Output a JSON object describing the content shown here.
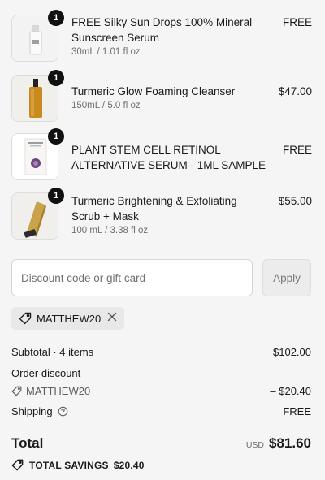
{
  "cart": {
    "items": [
      {
        "quantity": "1",
        "name": "FREE Silky Sun Drops 100% Mineral Sunscreen Serum",
        "variant": "30mL / 1.01 fl oz",
        "price": "FREE"
      },
      {
        "quantity": "1",
        "name": "Turmeric Glow Foaming Cleanser",
        "variant": "150mL / 5.0 fl oz",
        "price": "$47.00"
      },
      {
        "quantity": "1",
        "name": "PLANT STEM CELL RETINOL ALTERNATIVE SERUM - 1ML SAMPLE",
        "variant": "",
        "price": "FREE"
      },
      {
        "quantity": "1",
        "name": "Turmeric Brightening & Exfoliating Scrub + Mask",
        "variant": "100 mL / 3.38 fl oz",
        "price": "$55.00"
      }
    ]
  },
  "discount": {
    "placeholder": "Discount code or gift card",
    "value": "",
    "apply_label": "Apply",
    "applied_code": "MATTHEW20"
  },
  "summary": {
    "subtotal_label": "Subtotal · 4 items",
    "subtotal_value": "$102.00",
    "order_discount_label": "Order discount",
    "discount_code": "MATTHEW20",
    "discount_value": "– $20.40",
    "shipping_label": "Shipping",
    "shipping_value": "FREE",
    "total_label": "Total",
    "currency": "USD",
    "total_value": "$81.60",
    "savings_label": "TOTAL SAVINGS",
    "savings_value": "$20.40"
  },
  "icons": {
    "tag": "tag-icon",
    "help": "help-circle-icon",
    "close": "close-icon"
  }
}
